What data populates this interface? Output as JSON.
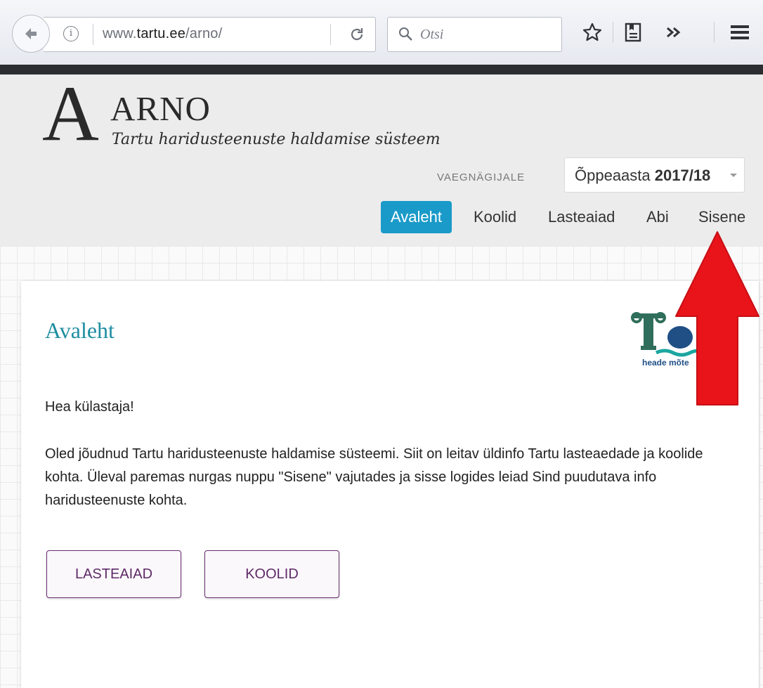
{
  "browser": {
    "url_prefix": "www.",
    "url_domain": "tartu.ee",
    "url_path": "/arno/",
    "info_glyph": "i",
    "search_placeholder": "Otsi",
    "icons": [
      "back-arrow-icon",
      "info-icon",
      "reload-icon",
      "search-icon",
      "bookmark-star-icon",
      "reading-list-icon",
      "overflow-chevron-icon",
      "hamburger-menu-icon"
    ]
  },
  "header": {
    "logo_letter": "A",
    "app_name": "ARNO",
    "tagline": "Tartu haridusteenuste haldamise süsteem",
    "accessibility_link": "VAEGNÄGIJALE",
    "year_label": "Õppeaasta",
    "year_value": "2017/18"
  },
  "nav": {
    "items": [
      "Avaleht",
      "Koolid",
      "Lasteaiad",
      "Abi",
      "Sisene"
    ],
    "active": "Avaleht"
  },
  "main": {
    "title": "Avaleht",
    "greeting": "Hea külastaja!",
    "intro": "Oled jõudnud Tartu haridusteenuste haldamise süsteemi. Siit on leitav üldinfo Tartu lasteaedade ja koolide kohta. Üleval paremas nurgas nuppu \"Sisene\" vajutades ja sisse logides leiad Sind puudutava info haridusteenuste kohta.",
    "buttons": [
      "LASTEAIAD",
      "KOOLID"
    ],
    "logo_text": "heade mõte"
  },
  "colors": {
    "nav_active": "#1a9ac9",
    "title": "#1e8ea0",
    "button_text": "#5e2a66",
    "annotation_arrow": "#e8141a"
  }
}
